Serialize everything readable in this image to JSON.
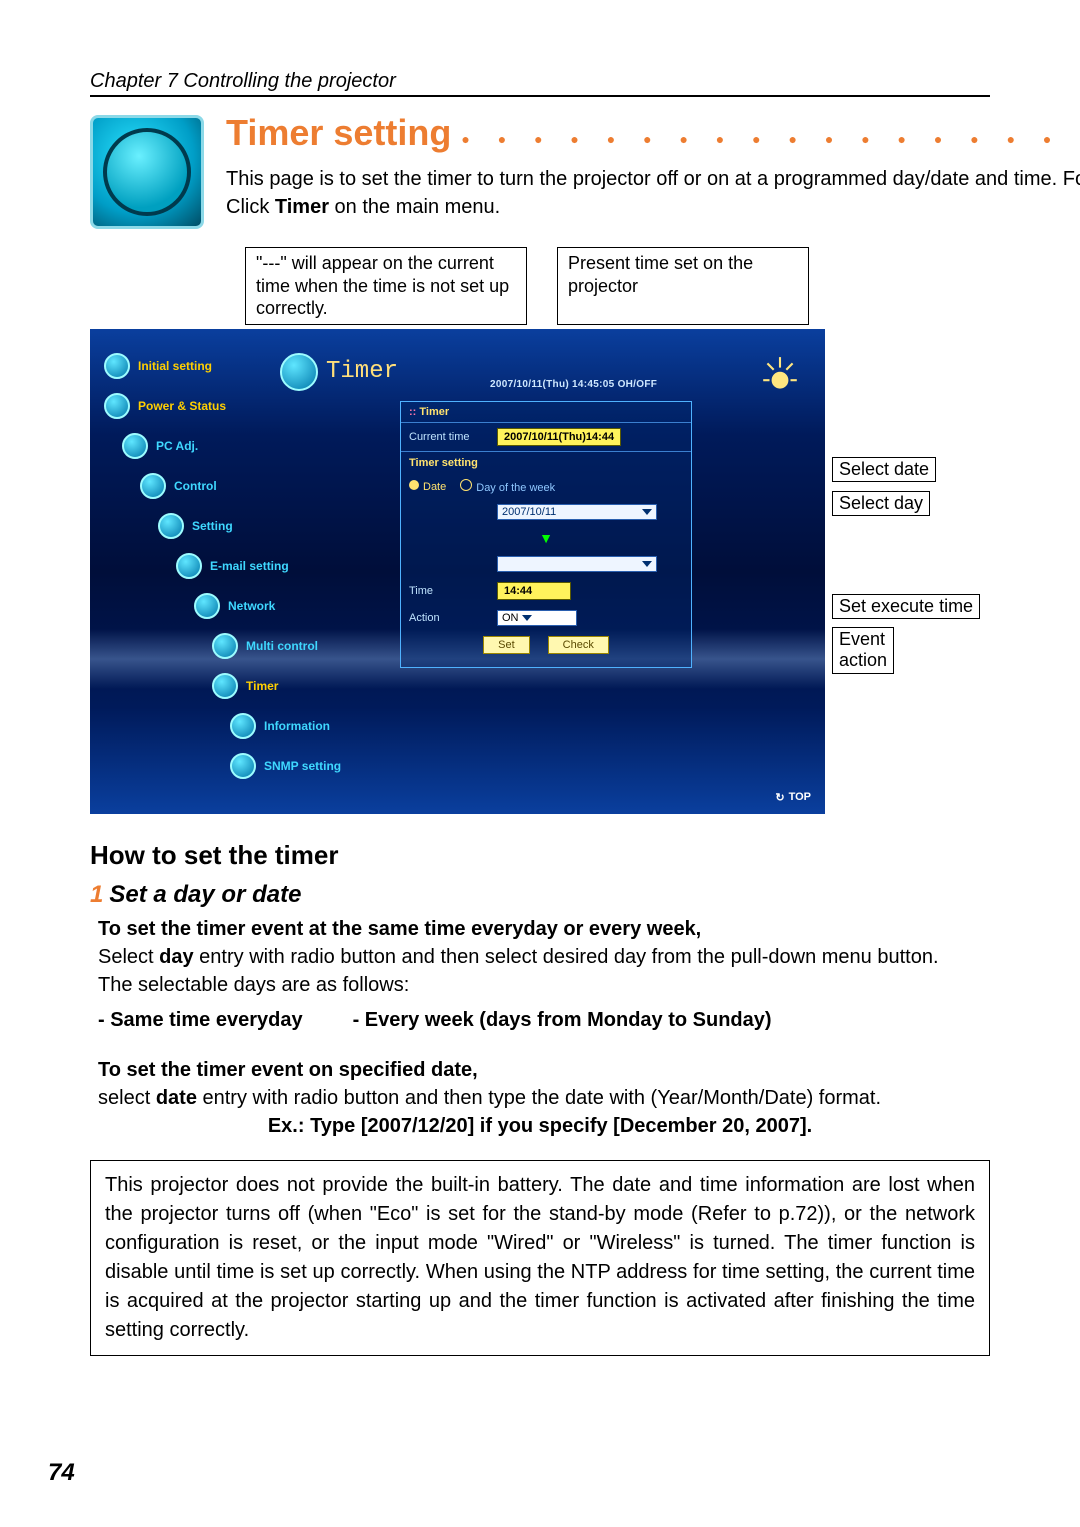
{
  "chapter": "Chapter 7 Controlling the projector",
  "title": "Timer setting",
  "desc_line1": "This page is to set the timer to turn the projector off or on at a programmed day/date and time. Follow the steps below for setting.",
  "desc_line2_pre": "Click ",
  "desc_line2_bold": "Timer",
  "desc_line2_post": " on the main menu.",
  "callout_left": "\"---\" will appear on the current time when the time is not set up correctly.",
  "callout_right": "Present time set on the projector",
  "right_callouts": {
    "select_date": "Select date",
    "select_day": "Select day",
    "set_execute": "Set execute time",
    "event_action": "Event action"
  },
  "screenshot": {
    "sidebar": [
      "Initial setting",
      "Power & Status",
      "PC Adj.",
      "Control",
      "Setting",
      "E-mail setting",
      "Network",
      "Multi control",
      "Timer",
      "Information",
      "SNMP setting"
    ],
    "panel_title": "Timer",
    "present_time": "2007/10/11(Thu) 14:45:05  OH/OFF",
    "timer_hdr": "Timer",
    "cur_time_lbl": "Current time",
    "cur_time_val": "2007/10/11(Thu)14:44",
    "set_hdr": "Timer setting",
    "date_lbl": "Date",
    "dow_lbl": "Day of the week",
    "date_val": "2007/10/11",
    "time_lbl": "Time",
    "time_val": "14:44",
    "action_lbl": "Action",
    "action_val": "ON",
    "set_btn": "Set",
    "check_btn": "Check",
    "top_link": "TOP"
  },
  "subhead": "How to set the timer",
  "step1": {
    "num": "1",
    "title": "Set a day or date",
    "p1_bold": "To set the timer event at the same time everyday or every week,",
    "p2_a": "Select ",
    "p2_b": "day",
    "p2_c": " entry with radio button and then select desired day from the pull-down menu button.",
    "p3": "The selectable days are as follows:",
    "opt1": "- Same time everyday",
    "opt2": "- Every week (days from Monday to Sunday)",
    "p4_bold": "To set the timer event on specified date,",
    "p5_a": "select ",
    "p5_b": "date",
    "p5_c": " entry with radio button and then type the date with (Year/Month/Date) format.",
    "ex": "Ex.: Type [2007/12/20] if you specify [December 20, 2007]."
  },
  "note": "This projector does not provide the built-in battery. The date and time information are lost when the projector turns off (when \"Eco\" is set for the stand-by mode (Refer to p.72)), or the network configuration is reset, or the input mode \"Wired\" or \"Wireless\" is turned. The timer function is disable until time is set up correctly. When using the NTP address for time setting, the current time is acquired at the projector starting up and the timer function is activated after finishing the time setting correctly.",
  "page_num": "74"
}
